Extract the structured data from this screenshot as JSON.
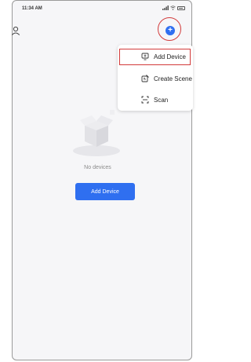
{
  "status": {
    "time": "11:34 AM"
  },
  "menu": {
    "items": [
      {
        "label": "Add Device",
        "icon": "add-device-icon"
      },
      {
        "label": "Create Scene",
        "icon": "create-scene-icon"
      },
      {
        "label": "Scan",
        "icon": "scan-icon"
      }
    ]
  },
  "empty_state": {
    "message": "No devices",
    "button_label": "Add Device"
  },
  "colors": {
    "accent": "#2f6ff0",
    "highlight": "#d23a3a"
  }
}
